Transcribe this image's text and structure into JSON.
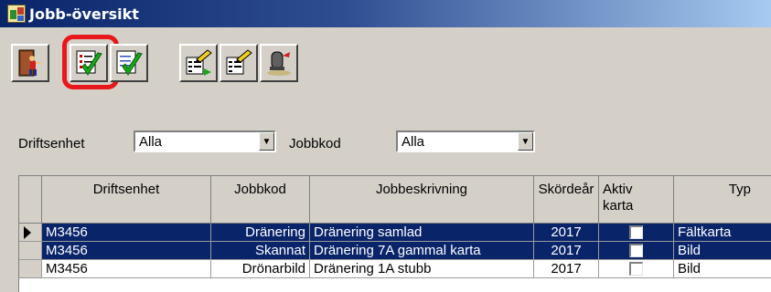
{
  "window": {
    "title": "Jobb-översikt"
  },
  "toolbar": {
    "buttons": [
      {
        "icon": "exit-door-icon"
      },
      {
        "icon": "checklist-check-icon",
        "highlighted": true
      },
      {
        "icon": "checklist-check-icon"
      },
      {
        "icon": "edit-document-icon"
      },
      {
        "icon": "edit-document-icon"
      },
      {
        "icon": "document-stamp-icon"
      }
    ]
  },
  "filters": {
    "driftsenhet_label": "Driftsenhet",
    "driftsenhet_value": "Alla",
    "jobbkod_label": "Jobbkod",
    "jobbkod_value": "Alla"
  },
  "grid": {
    "columns": {
      "driftsenhet": "Driftsenhet",
      "jobbkod": "Jobbkod",
      "jobbeskrivning": "Jobbeskrivning",
      "skordear": "Skördeår",
      "aktiv_karta_1": "Aktiv",
      "aktiv_karta_2": "karta",
      "typ": "Typ"
    },
    "rows": [
      {
        "driftsenhet": "M3456",
        "jobbkod": "Dränering",
        "jobbeskrivning": "Dränering samlad",
        "skordear": "2017",
        "aktiv_karta": false,
        "typ": "Fältkarta",
        "selected": true,
        "current": true
      },
      {
        "driftsenhet": "M3456",
        "jobbkod": "Skannat",
        "jobbeskrivning": "Dränering 7A gammal karta",
        "skordear": "2017",
        "aktiv_karta": false,
        "typ": "Bild",
        "selected": true,
        "current": false
      },
      {
        "driftsenhet": "M3456",
        "jobbkod": "Drönarbild",
        "jobbeskrivning": "Dränering 1A stubb",
        "skordear": "2017",
        "aktiv_karta": false,
        "typ": "Bild",
        "selected": false,
        "current": false
      }
    ]
  },
  "colors": {
    "titlebar_start": "#0a246a",
    "selection": "#0a246a",
    "highlight_ring": "#e8171b"
  }
}
